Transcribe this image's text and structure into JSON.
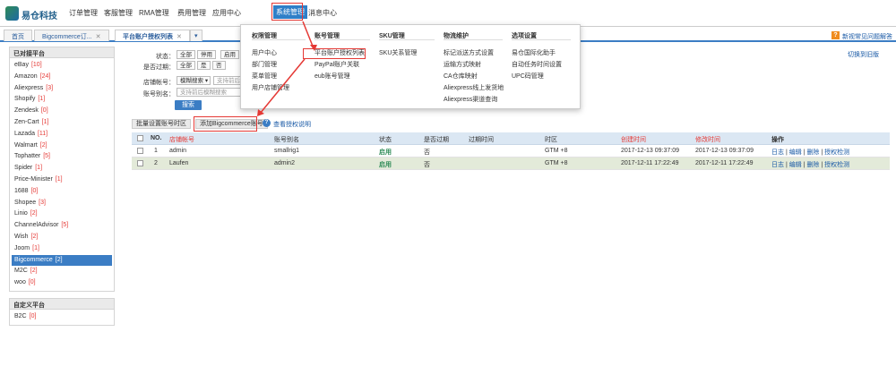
{
  "app": {
    "logo_text": "易仓科技"
  },
  "nav": {
    "items": [
      "订单管理",
      "客服管理",
      "RMA管理",
      "费用管理",
      "应用中心",
      "系统管理",
      "消息中心"
    ],
    "active_index": 5
  },
  "tabs": [
    {
      "label": "首页"
    },
    {
      "label": "Bigcommerce订..."
    },
    {
      "label": "平台账户授权列表"
    }
  ],
  "help_link": "新视常见问题解答",
  "switch_old": "切换到旧版",
  "sidebar": {
    "section1": "已对接平台",
    "items": [
      {
        "name": "eBay",
        "count": "[10]"
      },
      {
        "name": "Amazon",
        "count": "[24]"
      },
      {
        "name": "Aliexpress",
        "count": "[3]"
      },
      {
        "name": "Shopify",
        "count": "[1]"
      },
      {
        "name": "Zendesk",
        "count": "[0]"
      },
      {
        "name": "Zen-Cart",
        "count": "[1]"
      },
      {
        "name": "Lazada",
        "count": "[11]"
      },
      {
        "name": "Walmart",
        "count": "[2]"
      },
      {
        "name": "Tophatter",
        "count": "[5]"
      },
      {
        "name": "Spider",
        "count": "[1]"
      },
      {
        "name": "Price-Minister",
        "count": "[1]"
      },
      {
        "name": "1688",
        "count": "[0]"
      },
      {
        "name": "Shopee",
        "count": "[3]"
      },
      {
        "name": "Linio",
        "count": "[2]"
      },
      {
        "name": "ChannelAdvisor",
        "count": "[5]"
      },
      {
        "name": "Wish",
        "count": "[2]"
      },
      {
        "name": "Joom",
        "count": "[1]"
      },
      {
        "name": "Bigcommerce",
        "count": "[2]"
      },
      {
        "name": "M2C",
        "count": "[2]"
      },
      {
        "name": "woo",
        "count": "[0]"
      }
    ],
    "active_index": 17,
    "section2": "自定义平台",
    "custom_items": [
      {
        "name": "B2C",
        "count": "[0]"
      }
    ]
  },
  "filters": {
    "status_label": "状态：",
    "status_options": [
      "全部",
      "停用",
      "启用"
    ],
    "expired_label": "是否过期：",
    "expired_options": [
      "全部",
      "是",
      "否"
    ],
    "store_label": "店铺帐号：",
    "store_mode": "模糊搜索",
    "store_placeholder": "支持前后模",
    "alias_label": "账号别名：",
    "alias_placeholder": "支持前后模糊搜索",
    "search_button": "搜索"
  },
  "actions": {
    "batch_expiry": "批量设置账号时区",
    "add_account": "添加Bigcommerce账号",
    "auth_help": "查看授权说明"
  },
  "table": {
    "headers": [
      "NO.",
      "店铺帐号",
      "账号别名",
      "状态",
      "是否过期",
      "过期时间",
      "时区",
      "创建时间",
      "修改时间",
      "操作"
    ],
    "rows": [
      {
        "no": "1",
        "account": "admin",
        "alias": "smallrig1",
        "status": "启用",
        "expired": "否",
        "expire_time": "",
        "timezone": "GTM +8",
        "created": "2017-12-13 09:37:09",
        "modified": "2017-12-13 09:37:09"
      },
      {
        "no": "2",
        "account": "Laufen",
        "alias": "admin2",
        "status": "启用",
        "expired": "否",
        "expire_time": "",
        "timezone": "GTM +8",
        "created": "2017-12-11 17:22:49",
        "modified": "2017-12-11 17:22:49"
      }
    ],
    "row_actions": [
      "日志",
      "编辑",
      "删除",
      "授权检测"
    ]
  },
  "dropdown": {
    "columns": [
      {
        "title": "权限管理",
        "items": [
          "用户中心",
          "部门管理",
          "菜单管理",
          "用户店铺管理"
        ]
      },
      {
        "title": "账号管理",
        "items": [
          "平台账户授权列表",
          "PayPal账户关联",
          "eub账号管理"
        ]
      },
      {
        "title": "SKU管理",
        "items": [
          "SKU关系管理"
        ]
      },
      {
        "title": "物流维护",
        "items": [
          "标记派送方式设置",
          "运输方式映射",
          "CA仓库映射",
          "Aliexpress线上发货地",
          "Aliexpress渠道查询"
        ]
      },
      {
        "title": "选项设置",
        "items": [
          "易仓国际化助手",
          "自动任务时间设置",
          "UPC码管理"
        ]
      }
    ]
  }
}
